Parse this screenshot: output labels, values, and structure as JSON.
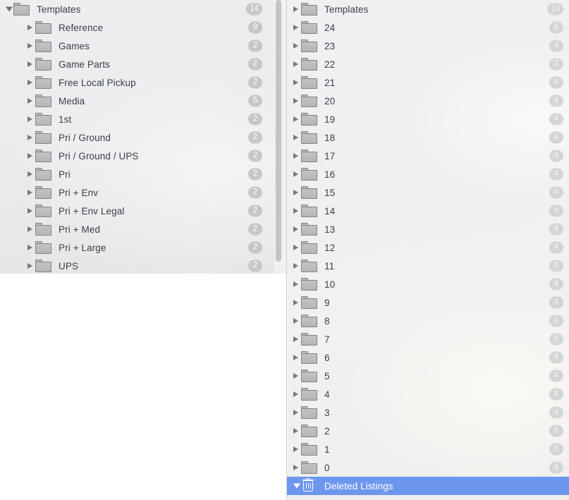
{
  "window": {
    "title": "Listing Folders",
    "selection_color": "#6d96ee",
    "badge_color": "#c6c7c8",
    "text_color": "#3b4048"
  },
  "left_panel": {
    "name": "templates-folder-tree",
    "root": {
      "label": "Templates",
      "badge": "14",
      "icon": "folder-icon",
      "expanded": true
    },
    "items": [
      {
        "label": "Reference",
        "badge": "9",
        "icon": "folder-icon",
        "expanded": false
      },
      {
        "label": "Games",
        "badge": "2",
        "icon": "folder-icon",
        "expanded": false
      },
      {
        "label": "Game Parts",
        "badge": "2",
        "icon": "folder-icon",
        "expanded": false
      },
      {
        "label": "Free Local Pickup",
        "badge": "2",
        "icon": "folder-icon",
        "expanded": false
      },
      {
        "label": "Media",
        "badge": "5",
        "icon": "folder-icon",
        "expanded": false
      },
      {
        "label": "1st",
        "badge": "2",
        "icon": "folder-icon",
        "expanded": false
      },
      {
        "label": "Pri / Ground",
        "badge": "2",
        "icon": "folder-icon",
        "expanded": false
      },
      {
        "label": "Pri / Ground / UPS",
        "badge": "2",
        "icon": "folder-icon",
        "expanded": false
      },
      {
        "label": "Pri",
        "badge": "2",
        "icon": "folder-icon",
        "expanded": false
      },
      {
        "label": "Pri + Env",
        "badge": "2",
        "icon": "folder-icon",
        "expanded": false
      },
      {
        "label": "Pri + Env Legal",
        "badge": "2",
        "icon": "folder-icon",
        "expanded": false
      },
      {
        "label": "Pri + Med",
        "badge": "2",
        "icon": "folder-icon",
        "expanded": false
      },
      {
        "label": "Pri + Large",
        "badge": "2",
        "icon": "folder-icon",
        "expanded": false
      },
      {
        "label": "UPS",
        "badge": "2",
        "icon": "folder-icon",
        "expanded": false
      }
    ]
  },
  "right_panel": {
    "name": "listing-folder-list",
    "items": [
      {
        "label": "Templates",
        "badge": "14",
        "icon": "folder-icon",
        "expanded": false,
        "selected": false
      },
      {
        "label": "24",
        "badge": "4",
        "icon": "folder-icon",
        "expanded": false,
        "selected": false
      },
      {
        "label": "23",
        "badge": "4",
        "icon": "folder-icon",
        "expanded": false,
        "selected": false
      },
      {
        "label": "22",
        "badge": "3",
        "icon": "folder-icon",
        "expanded": false,
        "selected": false
      },
      {
        "label": "21",
        "badge": "4",
        "icon": "folder-icon",
        "expanded": false,
        "selected": false
      },
      {
        "label": "20",
        "badge": "4",
        "icon": "folder-icon",
        "expanded": false,
        "selected": false
      },
      {
        "label": "19",
        "badge": "4",
        "icon": "folder-icon",
        "expanded": false,
        "selected": false
      },
      {
        "label": "18",
        "badge": "4",
        "icon": "folder-icon",
        "expanded": false,
        "selected": false
      },
      {
        "label": "17",
        "badge": "4",
        "icon": "folder-icon",
        "expanded": false,
        "selected": false
      },
      {
        "label": "16",
        "badge": "4",
        "icon": "folder-icon",
        "expanded": false,
        "selected": false
      },
      {
        "label": "15",
        "badge": "4",
        "icon": "folder-icon",
        "expanded": false,
        "selected": false
      },
      {
        "label": "14",
        "badge": "4",
        "icon": "folder-icon",
        "expanded": false,
        "selected": false
      },
      {
        "label": "13",
        "badge": "4",
        "icon": "folder-icon",
        "expanded": false,
        "selected": false
      },
      {
        "label": "12",
        "badge": "4",
        "icon": "folder-icon",
        "expanded": false,
        "selected": false
      },
      {
        "label": "11",
        "badge": "5",
        "icon": "folder-icon",
        "expanded": false,
        "selected": false
      },
      {
        "label": "10",
        "badge": "4",
        "icon": "folder-icon",
        "expanded": false,
        "selected": false
      },
      {
        "label": "9",
        "badge": "4",
        "icon": "folder-icon",
        "expanded": false,
        "selected": false
      },
      {
        "label": "8",
        "badge": "4",
        "icon": "folder-icon",
        "expanded": false,
        "selected": false
      },
      {
        "label": "7",
        "badge": "4",
        "icon": "folder-icon",
        "expanded": false,
        "selected": false
      },
      {
        "label": "6",
        "badge": "4",
        "icon": "folder-icon",
        "expanded": false,
        "selected": false
      },
      {
        "label": "5",
        "badge": "4",
        "icon": "folder-icon",
        "expanded": false,
        "selected": false
      },
      {
        "label": "4",
        "badge": "4",
        "icon": "folder-icon",
        "expanded": false,
        "selected": false
      },
      {
        "label": "3",
        "badge": "4",
        "icon": "folder-icon",
        "expanded": false,
        "selected": false
      },
      {
        "label": "2",
        "badge": "5",
        "icon": "folder-icon",
        "expanded": false,
        "selected": false
      },
      {
        "label": "1",
        "badge": "5",
        "icon": "folder-icon",
        "expanded": false,
        "selected": false
      },
      {
        "label": "0",
        "badge": "4",
        "icon": "folder-icon",
        "expanded": false,
        "selected": false
      },
      {
        "label": "Deleted Listings",
        "badge": "",
        "icon": "trash-icon",
        "expanded": true,
        "selected": true
      }
    ]
  }
}
